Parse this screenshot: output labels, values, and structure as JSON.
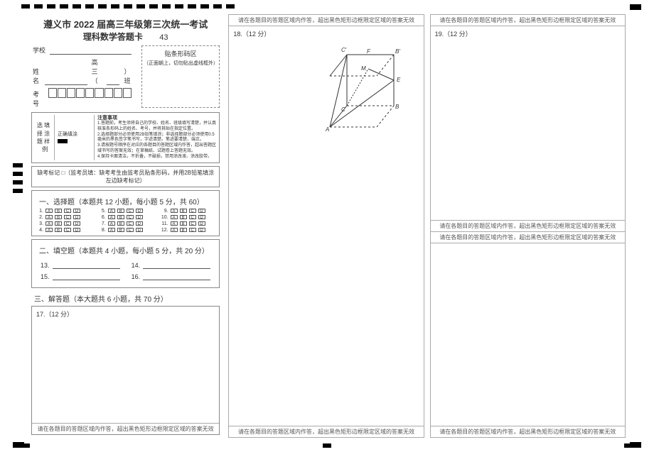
{
  "header": {
    "title_line1": "遵义市 2022 届高三年级第三次统一考试",
    "title_line2": "理科数学答题卡",
    "card_number": "43"
  },
  "student_info": {
    "school_label": "学校",
    "name_label": "姓名",
    "class_pre": "高三（",
    "class_post": "）班",
    "kh_label": "考号"
  },
  "barcode_box": {
    "line1": "贴条形码区",
    "line2": "（正面朝上，切勿贴出虚线框外）"
  },
  "fill_demo": {
    "col_title_1": "选",
    "col_title_2": "择",
    "col_title_3": "题",
    "col_title_4": "填",
    "col_title_5": "涂",
    "col_title_6": "样",
    "col_title_7": "例",
    "correct_label": "正确填涂",
    "notice_label": "注意事项",
    "notice_text": "1.答题前，考生须将自己的学校、姓名、班级填写清楚，并认真核准条形码上的姓名、考号，并将其贴在指定位置。\n2.选择题部分必须使用2B铅笔填涂；非选择题部分必须使用0.5毫米的黑色签字笔书写，字迹清楚。笔迹要清楚、端正。\n3.请按题号顺序在对应的各题目的答题区域内作答，超出答题区域书写的答案无效；在草稿纸、试题卷上答题无效。\n4.保持卡面清洁，不折叠，不破损，禁用涂改液、涂改胶带。"
  },
  "mark_note": "缺考标记 □（监考员填：缺考考生由监考员贴条形码，并用2B铅笔填涂左边缺考标记）",
  "section1": {
    "title": "一、选择题（本题共 12 小题，每小题 5 分，共 60）",
    "options": [
      "A",
      "B",
      "C",
      "D"
    ],
    "rows": [
      1,
      2,
      3,
      4,
      5,
      6,
      7,
      8,
      9,
      10,
      11,
      12
    ]
  },
  "section2": {
    "title": "二、填空题（本题共 4 小题，每小题 5 分，共 20 分）",
    "items": [
      "13.",
      "14.",
      "15.",
      "16."
    ]
  },
  "section3": {
    "title": "三、解答题（本大题共 6 小题，共 70 分）",
    "q17": "17.（12 分）",
    "q18": "18.（12 分）",
    "q19": "19.（12 分）"
  },
  "geom_labels": {
    "A": "A",
    "B": "B",
    "Bp": "B′",
    "C": "C",
    "Cp": "C′",
    "E": "E",
    "F": "F",
    "M": "M"
  },
  "boundary_notice": "请在各题目的答题区域内作答，超出黑色矩形边框限定区域的答案无效"
}
